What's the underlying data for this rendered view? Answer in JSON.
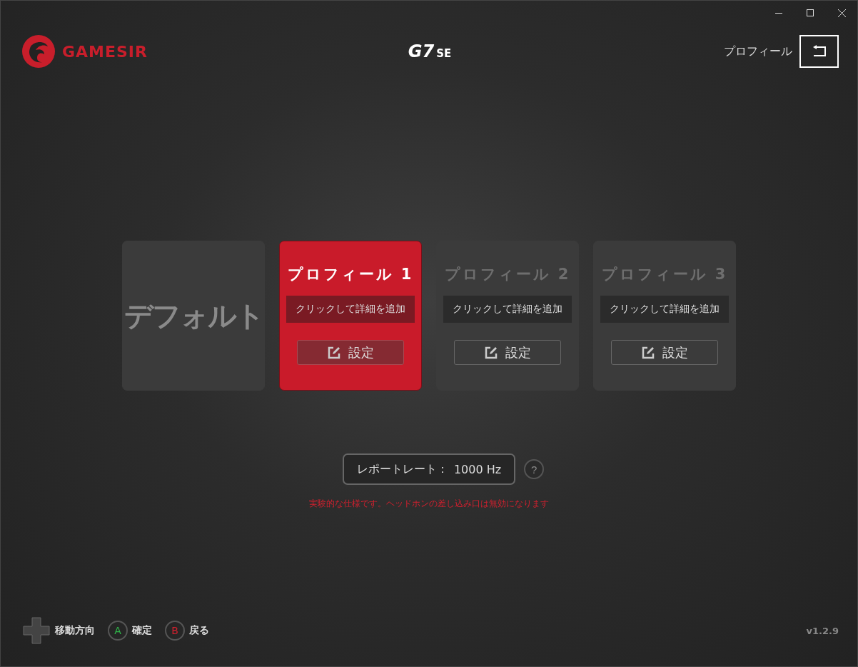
{
  "brand": {
    "logo": "GAMESIR",
    "model": "G7",
    "model_suffix": "SE"
  },
  "header": {
    "profile_label": "プロフィール"
  },
  "profiles": [
    {
      "kind": "default",
      "title": "デフォルト",
      "selected": false
    },
    {
      "kind": "custom",
      "title": "プロフィール 1",
      "description": "クリックして詳細を追加",
      "button": "設定",
      "selected": true
    },
    {
      "kind": "custom",
      "title": "プロフィール 2",
      "description": "クリックして詳細を追加",
      "button": "設定",
      "selected": false
    },
    {
      "kind": "custom",
      "title": "プロフィール 3",
      "description": "クリックして詳細を追加",
      "button": "設定",
      "selected": false
    }
  ],
  "report_rate": {
    "label": "レポートレート：",
    "value": "1000 Hz",
    "help": "?"
  },
  "warning": "実験的な仕様です。ヘッドホンの差し込み口は無効になります",
  "footer": {
    "hints": [
      {
        "kind": "dpad",
        "label": "移動方向"
      },
      {
        "kind": "button",
        "key": "A",
        "color": "#2fb84a",
        "label": "確定"
      },
      {
        "kind": "button",
        "key": "B",
        "color": "#d0202e",
        "label": "戻る"
      }
    ],
    "version": "v1.2.9"
  }
}
